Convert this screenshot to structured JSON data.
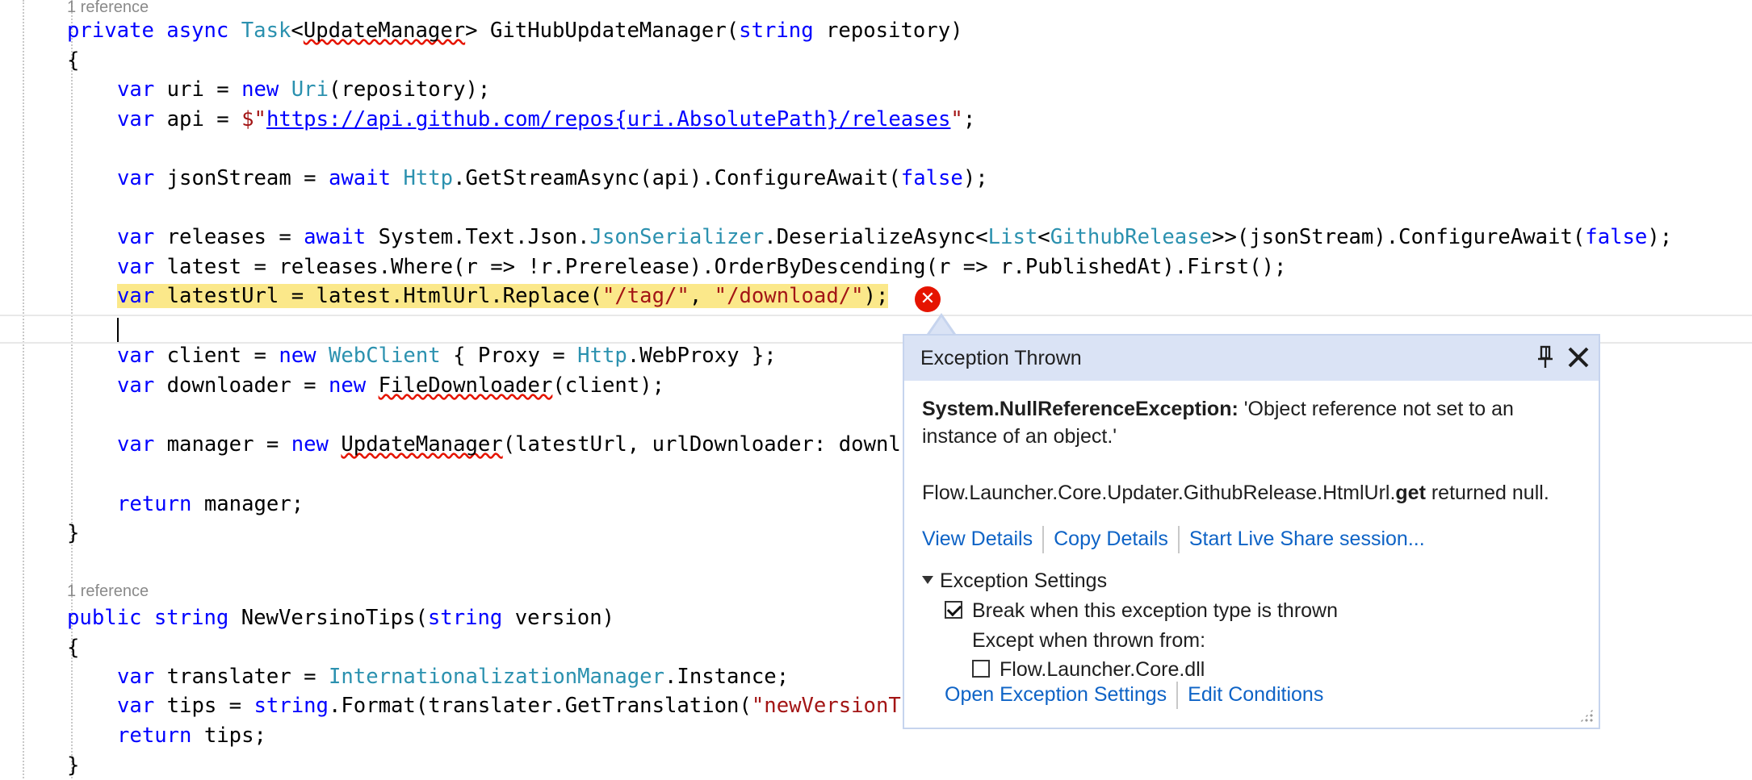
{
  "code": {
    "ref1": "1 reference",
    "ref2": "1 reference",
    "l01": [
      "private",
      " ",
      "async",
      " ",
      "Task",
      "<",
      "UpdateManager",
      "> GitHubUpdateManager(",
      "string",
      " repository)"
    ],
    "l02": "{",
    "l03": [
      "var",
      " uri = ",
      "new",
      " ",
      "Uri",
      "(repository);"
    ],
    "l04": [
      "var",
      " api = ",
      "$\"",
      "https://api.github.com/repos{uri.AbsolutePath}/releases",
      "\"",
      ";"
    ],
    "l05": [
      "var",
      " jsonStream = ",
      "await",
      " ",
      "Http",
      ".GetStreamAsync(api).ConfigureAwait(",
      "false",
      ");"
    ],
    "l06": [
      "var",
      " releases = ",
      "await",
      " System.Text.Json.",
      "JsonSerializer",
      ".DeserializeAsync<",
      "List",
      "<",
      "GithubRelease",
      ">>(jsonStream).ConfigureAwait(",
      "false",
      ");"
    ],
    "l07": [
      "var",
      " latest = releases.Where(r => !r.Prerelease).OrderByDescending(r => r.PublishedAt).First();"
    ],
    "l08": [
      "var",
      " latestUrl = latest.HtmlUrl.Replace(",
      "\"/tag/\"",
      ", ",
      "\"/download/\"",
      ");"
    ],
    "l09": [
      "var",
      " client = ",
      "new",
      " ",
      "WebClient",
      " { Proxy = ",
      "Http",
      ".WebProxy };"
    ],
    "l10": [
      "var",
      " downloader = ",
      "new",
      " ",
      "FileDownloader",
      "(client);"
    ],
    "l11": [
      "var",
      " manager = ",
      "new",
      " ",
      "UpdateManager",
      "(latestUrl, urlDownloader: downl"
    ],
    "l12": [
      "return",
      " manager;"
    ],
    "l13": "}",
    "l14": [
      "public",
      " ",
      "string",
      " NewVersinoTips(",
      "string",
      " version)"
    ],
    "l15": "{",
    "l16": [
      "var",
      " translater = ",
      "InternationalizationManager",
      ".Instance;"
    ],
    "l17": [
      "var",
      " tips = ",
      "string",
      ".Format(translater.GetTranslation(",
      "\"newVersionT"
    ],
    "l18": [
      "return",
      " tips;"
    ],
    "l19": "}"
  },
  "popup": {
    "title": "Exception Thrown",
    "exception_type": "System.NullReferenceException:",
    "exception_message": " 'Object reference not set to an instance of an object.'",
    "detail_prefix": "Flow.Launcher.Core.Updater.GithubRelease.HtmlUrl.",
    "detail_bold": "get",
    "detail_suffix": " returned null.",
    "links": [
      "View Details",
      "Copy Details",
      "Start Live Share session..."
    ],
    "settings_header": "Exception Settings",
    "break_label": "Break when this exception type is thrown",
    "break_checked": true,
    "except_label": "Except when thrown from:",
    "module_label": "Flow.Launcher.Core.dll",
    "module_checked": false,
    "open_settings": "Open Exception Settings",
    "edit_conditions": "Edit Conditions"
  },
  "colors": {
    "keyword": "#0000ff",
    "type": "#2b91af",
    "string": "#a31515",
    "highlight": "#fbe88a",
    "error": "#e51400",
    "link": "#0e63c6",
    "popup_header": "#dae3f5"
  },
  "icons": [
    "error-icon",
    "pin-icon",
    "close-icon",
    "expand-triangle-icon",
    "checkbox-icon",
    "resize-grip-icon"
  ]
}
